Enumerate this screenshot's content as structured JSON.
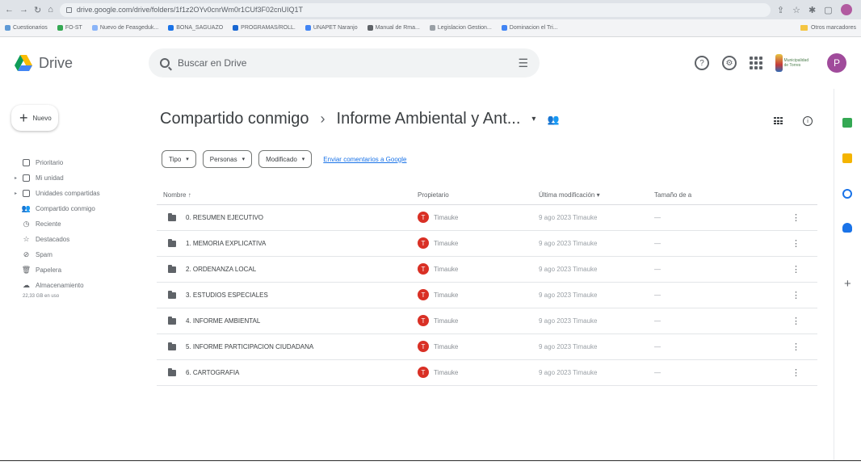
{
  "browser": {
    "url": "drive.google.com/drive/folders/1f1z2OYv0cnrWm0r1CUf3F02cnUIQ1T",
    "bookmarks": [
      "Cuestionarios",
      "FO-ST",
      "Nuevo de Feasgeduk...",
      "BONA_SAGUAZO",
      "PROGRAMAS/ROLL.",
      "UNAPET Naranjo",
      "Manual de Rma...",
      "Legislacion Gestion...",
      "Dominacion el Tri..."
    ],
    "bookmarks_right": "Otros marcadores"
  },
  "header": {
    "app_name": "Drive",
    "search_placeholder": "Buscar en Drive",
    "org_text": "Municipalidad de Torres",
    "user_initial": "P"
  },
  "sidebar": {
    "new_label": "Nuevo",
    "items": [
      {
        "label": "Prioritario",
        "icon": "priority-icon",
        "caret": false
      },
      {
        "label": "Mi unidad",
        "icon": "my-drive-icon",
        "caret": true
      },
      {
        "label": "Unidades compartidas",
        "icon": "shared-drives-icon",
        "caret": true
      },
      {
        "label": "Compartido conmigo",
        "icon": "shared-with-me-icon",
        "caret": false
      },
      {
        "label": "Reciente",
        "icon": "recent-icon",
        "caret": false
      },
      {
        "label": "Destacados",
        "icon": "starred-icon",
        "caret": false
      },
      {
        "label": "Spam",
        "icon": "spam-icon",
        "caret": false
      },
      {
        "label": "Papelera",
        "icon": "trash-icon",
        "caret": false
      },
      {
        "label": "Almacenamiento",
        "icon": "storage-icon",
        "caret": false
      }
    ],
    "storage_used": "22,33 GB en uso"
  },
  "breadcrumb": {
    "root": "Compartido conmigo",
    "current": "Informe Ambiental y Ant..."
  },
  "filters": {
    "chips": [
      "Tipo",
      "Personas",
      "Modificado"
    ],
    "link": "Enviar comentarios a Google"
  },
  "table": {
    "headers": {
      "name": "Nombre",
      "owner": "Propietario",
      "modified": "Última modificación",
      "size": "Tamaño de a"
    },
    "rows": [
      {
        "name": "0. RESUMEN EJECUTIVO",
        "owner_initial": "T",
        "owner": "Timauke",
        "modified": "9 ago 2023 Timauke",
        "size": "—"
      },
      {
        "name": "1. MEMORIA EXPLICATIVA",
        "owner_initial": "T",
        "owner": "Timauke",
        "modified": "9 ago 2023 Timauke",
        "size": "—"
      },
      {
        "name": "2. ORDENANZA LOCAL",
        "owner_initial": "T",
        "owner": "Timauke",
        "modified": "9 ago 2023 Timauke",
        "size": "—"
      },
      {
        "name": "3. ESTUDIOS ESPECIALES",
        "owner_initial": "T",
        "owner": "Timauke",
        "modified": "9 ago 2023 Timauke",
        "size": "—"
      },
      {
        "name": "4. INFORME AMBIENTAL",
        "owner_initial": "T",
        "owner": "Timauke",
        "modified": "9 ago 2023 Timauke",
        "size": "—"
      },
      {
        "name": "5. INFORME PARTICIPACION CIUDADANA",
        "owner_initial": "T",
        "owner": "Timauke",
        "modified": "9 ago 2023 Timauke",
        "size": "—"
      },
      {
        "name": "6. CARTOGRAFIA",
        "owner_initial": "T",
        "owner": "Timauke",
        "modified": "9 ago 2023 Timauke",
        "size": "—"
      }
    ]
  },
  "colors": {
    "owner_avatar": "#d93025",
    "user_avatar": "#a04b9b",
    "link": "#1a73e8",
    "keep": "#f4b400",
    "tasks": "#1a73e8",
    "contacts": "#1a73e8",
    "calendar": "#34a853"
  }
}
